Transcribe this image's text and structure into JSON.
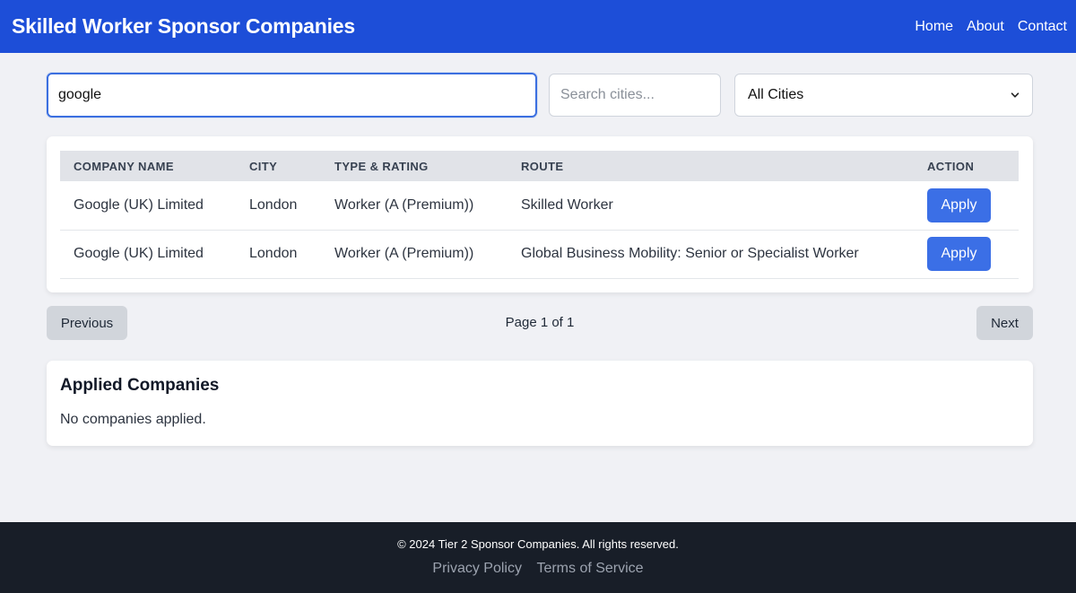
{
  "navbar": {
    "brand": "Skilled Worker Sponsor Companies",
    "links": [
      "Home",
      "About",
      "Contact"
    ]
  },
  "search": {
    "company_value": "google",
    "city_placeholder": "Search cities...",
    "city_value": "",
    "city_filter_selected": "All Cities"
  },
  "table": {
    "headers": [
      "COMPANY NAME",
      "CITY",
      "TYPE & RATING",
      "ROUTE",
      "ACTION"
    ],
    "rows": [
      {
        "company": "Google (UK) Limited",
        "city": "London",
        "type_rating": "Worker (A (Premium))",
        "route": "Skilled Worker",
        "action": "Apply"
      },
      {
        "company": "Google (UK) Limited",
        "city": "London",
        "type_rating": "Worker (A (Premium))",
        "route": "Global Business Mobility: Senior or Specialist Worker",
        "action": "Apply"
      }
    ]
  },
  "pagination": {
    "previous_label": "Previous",
    "page_info": "Page 1 of 1",
    "next_label": "Next"
  },
  "applied": {
    "title": "Applied Companies",
    "empty_message": "No companies applied."
  },
  "footer": {
    "copyright": "© 2024 Tier 2 Sponsor Companies. All rights reserved.",
    "links": [
      "Privacy Policy",
      "Terms of Service"
    ]
  },
  "colors": {
    "primary": "#1d4ed8",
    "button": "#3b6fe6",
    "footer_bg": "#181e28",
    "page_bg": "#f0f1f5"
  }
}
